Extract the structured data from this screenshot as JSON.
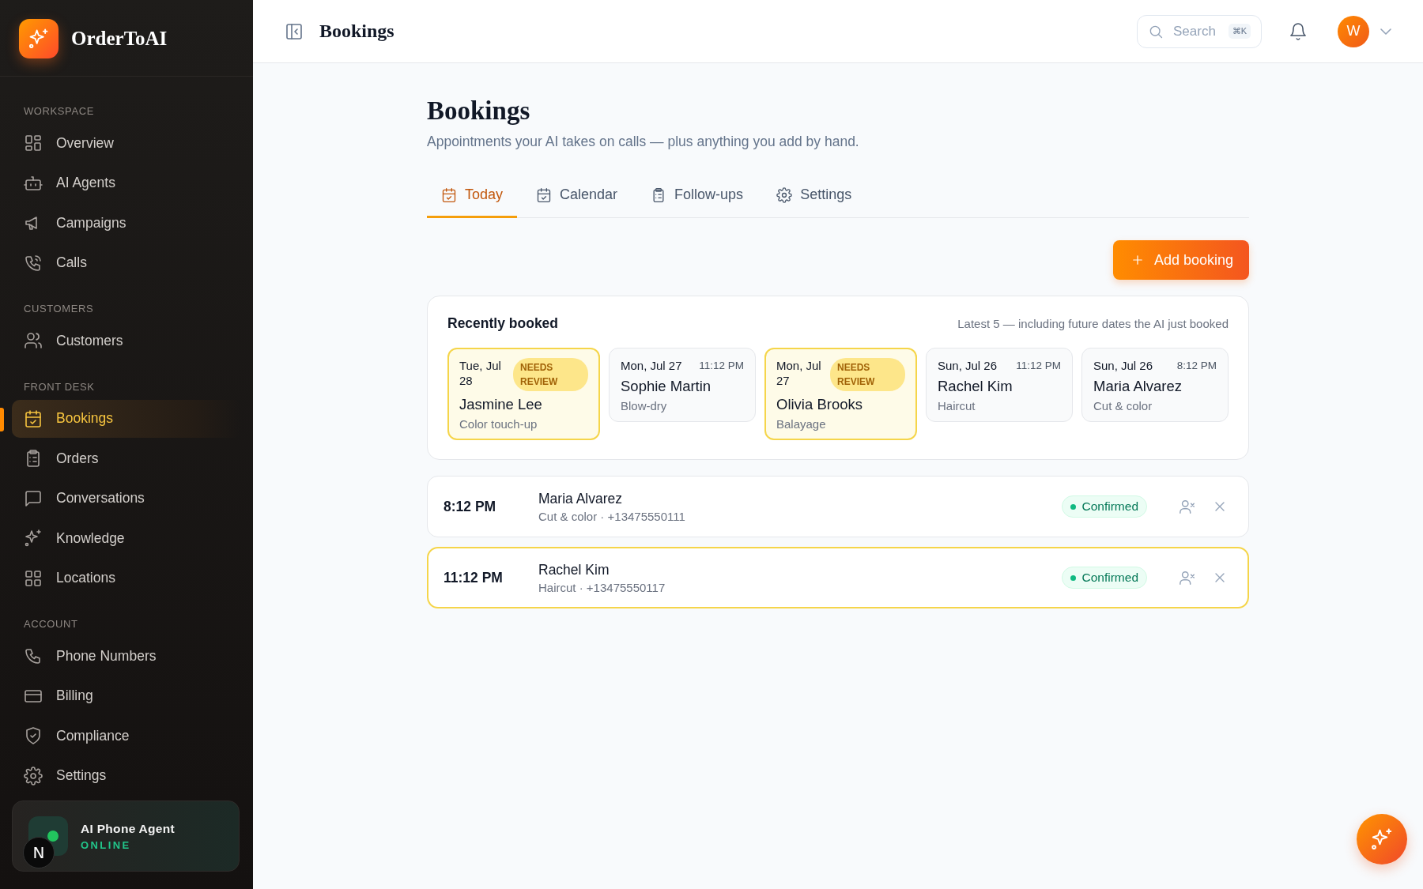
{
  "brand": {
    "name": "OrderToAI"
  },
  "sidebar": {
    "sections": [
      {
        "label": "WORKSPACE",
        "items": [
          {
            "label": "Overview",
            "selected": false
          },
          {
            "label": "AI Agents",
            "selected": false
          },
          {
            "label": "Campaigns",
            "selected": false
          },
          {
            "label": "Calls",
            "selected": false
          }
        ]
      },
      {
        "label": "CUSTOMERS",
        "items": [
          {
            "label": "Customers",
            "selected": false
          }
        ]
      },
      {
        "label": "FRONT DESK",
        "items": [
          {
            "label": "Bookings",
            "selected": true
          },
          {
            "label": "Orders",
            "selected": false
          },
          {
            "label": "Conversations",
            "selected": false
          },
          {
            "label": "Knowledge",
            "selected": false
          },
          {
            "label": "Locations",
            "selected": false
          }
        ]
      },
      {
        "label": "ACCOUNT",
        "items": [
          {
            "label": "Phone Numbers",
            "selected": false
          },
          {
            "label": "Billing",
            "selected": false
          },
          {
            "label": "Compliance",
            "selected": false
          },
          {
            "label": "Settings",
            "selected": false
          }
        ]
      }
    ],
    "agent_card": {
      "title": "AI Phone Agent",
      "status": "ONLINE"
    },
    "dev_badge": "N"
  },
  "header": {
    "title": "Bookings",
    "search": {
      "placeholder": "Search",
      "shortcut": "⌘K"
    },
    "avatar": "W"
  },
  "page": {
    "title": "Bookings",
    "subtitle": "Appointments your AI takes on calls — plus anything you add by hand.",
    "tabs": [
      {
        "label": "Today",
        "selected": true
      },
      {
        "label": "Calendar",
        "selected": false
      },
      {
        "label": "Follow-ups",
        "selected": false
      },
      {
        "label": "Settings",
        "selected": false
      }
    ],
    "add_button": "Add booking",
    "recent": {
      "title": "Recently booked",
      "note": "Latest 5 — including future dates the AI just booked",
      "cards": [
        {
          "date": "Tue, Jul 28",
          "needs_review": true,
          "badge": "NEEDS REVIEW",
          "name": "Jasmine Lee",
          "service": "Color touch-up"
        },
        {
          "date": "Mon, Jul 27",
          "needs_review": false,
          "time": "11:12 PM",
          "name": "Sophie Martin",
          "service": "Blow-dry"
        },
        {
          "date": "Mon, Jul 27",
          "needs_review": true,
          "badge": "NEEDS REVIEW",
          "name": "Olivia Brooks",
          "service": "Balayage"
        },
        {
          "date": "Sun, Jul 26",
          "needs_review": false,
          "time": "11:12 PM",
          "name": "Rachel Kim",
          "service": "Haircut"
        },
        {
          "date": "Sun, Jul 26",
          "needs_review": false,
          "time": "8:12 PM",
          "name": "Maria Alvarez",
          "service": "Cut & color"
        }
      ]
    },
    "rows": [
      {
        "time": "8:12 PM",
        "name": "Maria Alvarez",
        "detail": "Cut & color · +13475550111",
        "status": "Confirmed",
        "kind": "confirmed",
        "highlighted": false
      },
      {
        "time": "11:12 PM",
        "name": "Rachel Kim",
        "detail": "Haircut · +13475550117",
        "status": "Confirmed",
        "kind": "confirmed",
        "highlighted": true
      }
    ]
  }
}
